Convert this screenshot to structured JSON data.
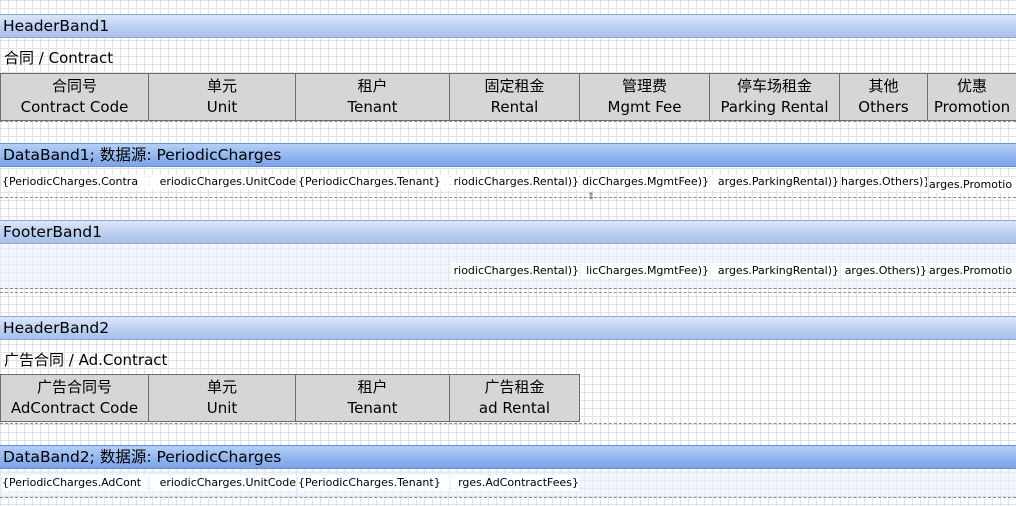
{
  "bands": {
    "header1": "HeaderBand1",
    "data1": "DataBand1; 数据源: PeriodicCharges",
    "footer1": "FooterBand1",
    "header2": "HeaderBand2",
    "data2": "DataBand2; 数据源: PeriodicCharges"
  },
  "contract": {
    "title": "合同 / Contract",
    "columns": [
      {
        "cn": "合同号",
        "en": "Contract Code"
      },
      {
        "cn": "单元",
        "en": "Unit"
      },
      {
        "cn": "租户",
        "en": "Tenant"
      },
      {
        "cn": "固定租金",
        "en": "Rental"
      },
      {
        "cn": "管理费",
        "en": "Mgmt Fee"
      },
      {
        "cn": "停车场租金",
        "en": "Parking Rental"
      },
      {
        "cn": "其他",
        "en": "Others"
      },
      {
        "cn": "优惠",
        "en": "Promotion"
      }
    ],
    "data_fields": [
      "{PeriodicCharges.Contra",
      "eriodicCharges.UnitCode",
      "{PeriodicCharges.Tenant}",
      "riodicCharges.Rental)}",
      "dicCharges.MgmtFee)}",
      "arges.ParkingRental)}",
      "harges.Others)}",
      "arges.Promotio"
    ],
    "footer_fields": [
      "riodicCharges.Rental)}",
      "licCharges.MgmtFee)}",
      "arges.ParkingRental)}",
      "arges.Others)}",
      "arges.Promotio"
    ]
  },
  "ad_contract": {
    "title": "广告合同 / Ad.Contract",
    "columns": [
      {
        "cn": "广告合同号",
        "en": "AdContract Code"
      },
      {
        "cn": "单元",
        "en": "Unit"
      },
      {
        "cn": "租户",
        "en": "Tenant"
      },
      {
        "cn": "广告租金",
        "en": "ad Rental"
      }
    ],
    "data_fields": [
      "{PeriodicCharges.AdCont",
      "eriodicCharges.UnitCode",
      "{PeriodicCharges.Tenant}",
      "rges.AdContractFees}"
    ]
  }
}
